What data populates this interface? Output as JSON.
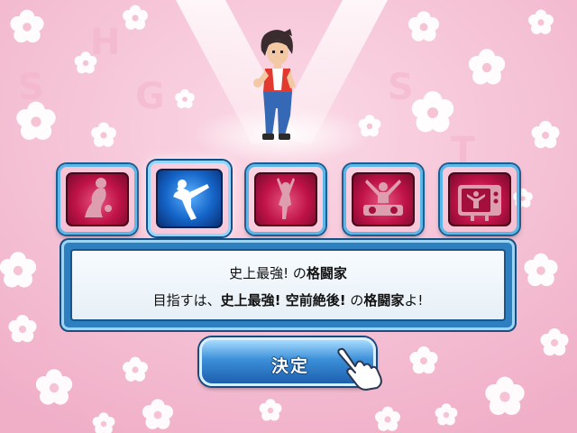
{
  "categories": [
    {
      "name": "model",
      "icon": "model-pose-icon",
      "selected": false
    },
    {
      "name": "fighter",
      "icon": "martial-artist-kick-icon",
      "selected": true
    },
    {
      "name": "dancer",
      "icon": "dancer-pose-icon",
      "selected": false
    },
    {
      "name": "dj",
      "icon": "dj-turntable-icon",
      "selected": false
    },
    {
      "name": "tv-star",
      "icon": "television-star-icon",
      "selected": false
    }
  ],
  "dialog": {
    "line1_part1": "史上最強!",
    "line1_part2": " の",
    "line1_part3": "格闘家",
    "line2_part1": "目指すは、",
    "line2_part2": "史上最強! 空前絶後!",
    "line2_part3": " の",
    "line2_part4": "格闘家",
    "line2_part5": "よ!"
  },
  "confirm": {
    "label": "決定",
    "pointer_icon": "pointing-hand-icon"
  },
  "colors": {
    "background": "#f6c6d8",
    "card_red": "#d4144f",
    "card_blue": "#1464c8",
    "frame_blue": "#2d7fc0"
  }
}
